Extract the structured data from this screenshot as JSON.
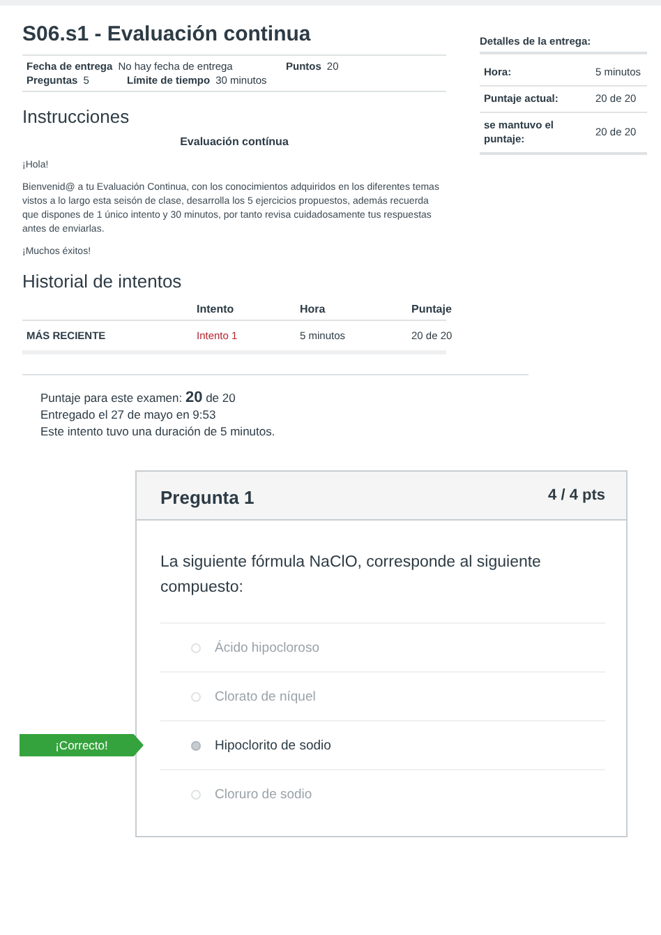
{
  "assignment": {
    "title": "S06.s1 - Evaluación continua",
    "meta": [
      {
        "label": "Fecha de entrega",
        "value": "No hay fecha de entrega"
      },
      {
        "label": "Puntos",
        "value": "20"
      },
      {
        "label": "Preguntas",
        "value": "5"
      },
      {
        "label": "Límite de tiempo",
        "value": "30 minutos"
      }
    ]
  },
  "instructions": {
    "heading": "Instrucciones",
    "subtitle": "Evaluación contínua",
    "paragraphs": [
      "¡Hola!",
      "Bienvenid@ a tu Evaluación Continua, con los conocimientos adquiridos en los diferentes temas vistos a lo largo esta seisón de clase, desarrolla los 5 ejercicios propuestos, además recuerda que dispones de 1 único intento y 30 minutos, por tanto revisa cuidadosamente tus respuestas antes de enviarlas.",
      "¡Muchos éxitos!"
    ]
  },
  "submission_details": {
    "heading": "Detalles de la entrega:",
    "rows": [
      {
        "label": "Hora:",
        "value": "5 minutos"
      },
      {
        "label": "Puntaje actual:",
        "value": "20 de 20"
      },
      {
        "label": "se mantuvo el puntaje:",
        "value": "20 de 20"
      }
    ]
  },
  "attempt_history": {
    "heading": "Historial de intentos",
    "columns": [
      "Intento",
      "Hora",
      "Puntaje"
    ],
    "rows": [
      {
        "label": "MÁS RECIENTE",
        "attempt": "Intento 1",
        "time": "5 minutos",
        "score": "20 de 20"
      }
    ]
  },
  "summary": [
    "Puntaje para este examen: **20** de 20",
    "Entregado el 27 de mayo en 9:53",
    "Este intento tuvo una duración de 5 minutos."
  ],
  "question": {
    "title": "Pregunta 1",
    "points": "4 / 4 pts",
    "text": "La siguiente fórmula NaClO, corresponde al siguiente compuesto:",
    "correct_label": "¡Correcto!",
    "answers": [
      {
        "text": "Ácido hipocloroso",
        "selected": false
      },
      {
        "text": "Clorato de níquel",
        "selected": false
      },
      {
        "text": "Hipoclorito de sodio",
        "selected": true
      },
      {
        "text": "Cloruro de sodio",
        "selected": false
      }
    ]
  }
}
